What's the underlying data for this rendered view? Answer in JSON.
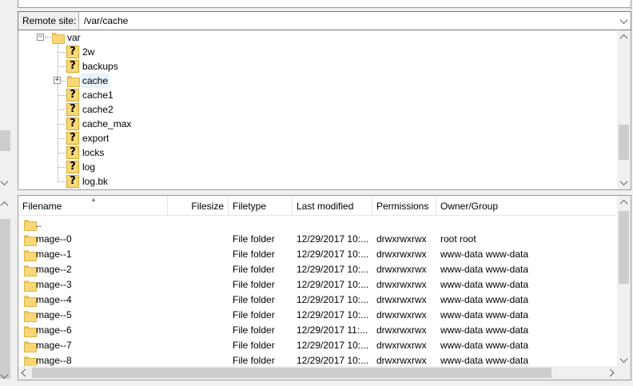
{
  "remote_site": {
    "label": "Remote site:",
    "path": "/var/cache"
  },
  "tree": {
    "root": {
      "label": "var",
      "expander": "−"
    },
    "items": [
      {
        "label": "2w",
        "icon": "unknown-folder-icon"
      },
      {
        "label": "backups",
        "icon": "unknown-folder-icon"
      },
      {
        "label": "cache",
        "icon": "folder-icon",
        "expander": "+",
        "selected": true
      },
      {
        "label": "cache1",
        "icon": "unknown-folder-icon"
      },
      {
        "label": "cache2",
        "icon": "unknown-folder-icon"
      },
      {
        "label": "cache_max",
        "icon": "unknown-folder-icon"
      },
      {
        "label": "export",
        "icon": "unknown-folder-icon"
      },
      {
        "label": "locks",
        "icon": "unknown-folder-icon"
      },
      {
        "label": "log",
        "icon": "unknown-folder-icon"
      },
      {
        "label": "log.bk",
        "icon": "unknown-folder-icon"
      }
    ]
  },
  "file_list": {
    "columns": [
      "Filename",
      "Filesize",
      "Filetype",
      "Last modified",
      "Permissions",
      "Owner/Group"
    ],
    "rows": [
      {
        "name": "..",
        "size": "",
        "type": "",
        "modified": "",
        "perms": "",
        "owner": ""
      },
      {
        "name": "mage--0",
        "size": "",
        "type": "File folder",
        "modified": "12/29/2017 10:...",
        "perms": "drwxrwxrwx",
        "owner": "root root"
      },
      {
        "name": "mage--1",
        "size": "",
        "type": "File folder",
        "modified": "12/29/2017 10:...",
        "perms": "drwxrwxrwx",
        "owner": "www-data www-data"
      },
      {
        "name": "mage--2",
        "size": "",
        "type": "File folder",
        "modified": "12/29/2017 10:...",
        "perms": "drwxrwxrwx",
        "owner": "www-data www-data"
      },
      {
        "name": "mage--3",
        "size": "",
        "type": "File folder",
        "modified": "12/29/2017 10:...",
        "perms": "drwxrwxrwx",
        "owner": "www-data www-data"
      },
      {
        "name": "mage--4",
        "size": "",
        "type": "File folder",
        "modified": "12/29/2017 10:...",
        "perms": "drwxrwxrwx",
        "owner": "www-data www-data"
      },
      {
        "name": "mage--5",
        "size": "",
        "type": "File folder",
        "modified": "12/29/2017 10:...",
        "perms": "drwxrwxrwx",
        "owner": "www-data www-data"
      },
      {
        "name": "mage--6",
        "size": "",
        "type": "File folder",
        "modified": "12/29/2017 11:...",
        "perms": "drwxrwxrwx",
        "owner": "www-data www-data"
      },
      {
        "name": "mage--7",
        "size": "",
        "type": "File folder",
        "modified": "12/29/2017 10:...",
        "perms": "drwxrwxrwx",
        "owner": "www-data www-data"
      },
      {
        "name": "mage--8",
        "size": "",
        "type": "File folder",
        "modified": "12/29/2017 10:...",
        "perms": "drwxrwxrwx",
        "owner": "www-data www-data"
      }
    ]
  },
  "colors": {
    "selection": "#e5f3ff",
    "folder": "#f8d775",
    "panel_bg": "#f0f0f0"
  }
}
